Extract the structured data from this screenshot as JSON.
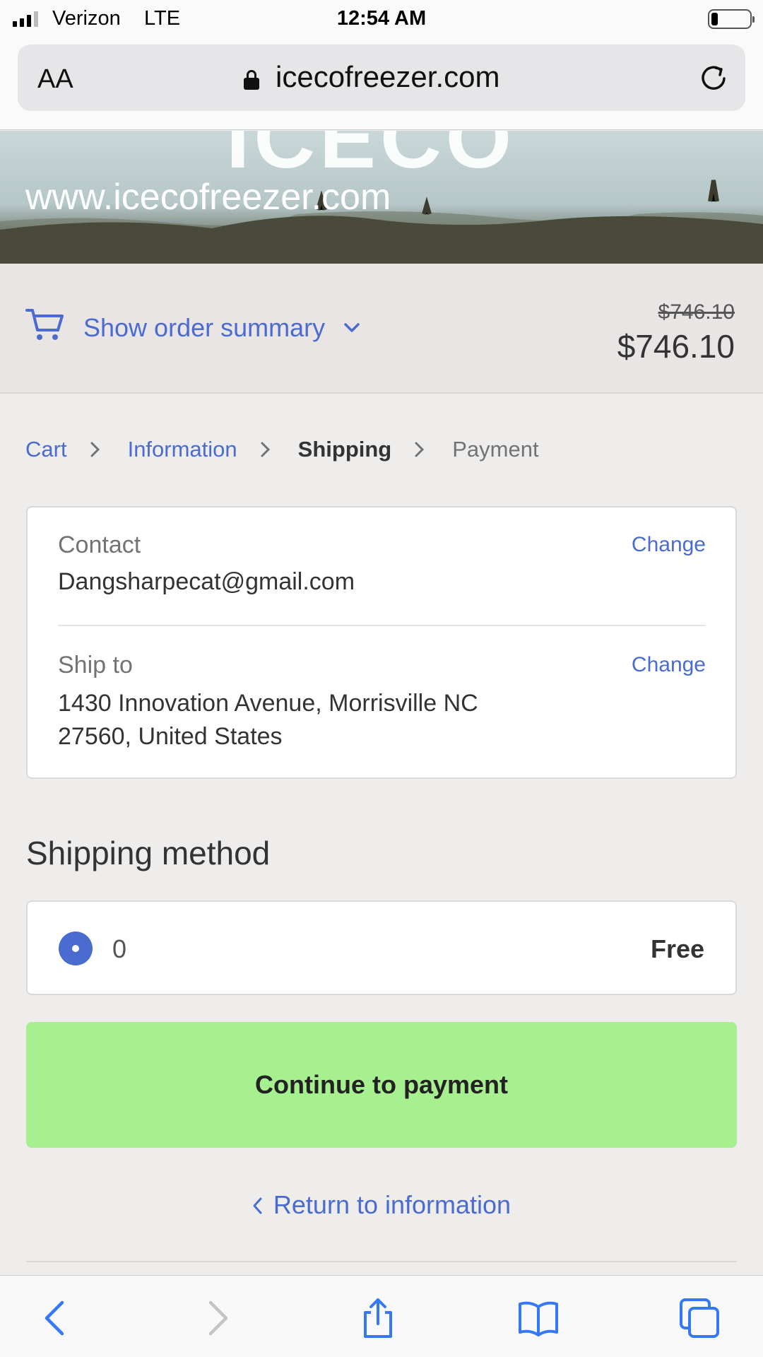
{
  "status_bar": {
    "carrier": "Verizon",
    "network": "LTE",
    "time": "12:54 AM"
  },
  "browser": {
    "text_size_label": "AA",
    "url": "icecofreezer.com"
  },
  "banner": {
    "logo_text": "ICECO",
    "site_text": "www.icecofreezer.com"
  },
  "order_summary": {
    "toggle_label": "Show order summary",
    "original_price": "$746.10",
    "total_price": "$746.10"
  },
  "breadcrumb": {
    "cart": "Cart",
    "information": "Information",
    "shipping": "Shipping",
    "payment": "Payment"
  },
  "review": {
    "contact_label": "Contact",
    "contact_value": "Dangsharpecat@gmail.com",
    "contact_change": "Change",
    "ship_to_label": "Ship to",
    "ship_to_line1": "1430 Innovation Avenue, Morrisville NC",
    "ship_to_line2": "27560, United States",
    "ship_to_change": "Change"
  },
  "shipping_method": {
    "heading": "Shipping method",
    "option_name": "0",
    "option_price": "Free"
  },
  "actions": {
    "continue_label": "Continue to payment",
    "return_label": "Return to information"
  },
  "colors": {
    "link": "#4a6bd0",
    "continue_button": "#a6f08f",
    "page_background": "#efecec"
  },
  "toolbar_icons": [
    "back-icon",
    "forward-icon",
    "share-icon",
    "bookmarks-icon",
    "tabs-icon"
  ]
}
